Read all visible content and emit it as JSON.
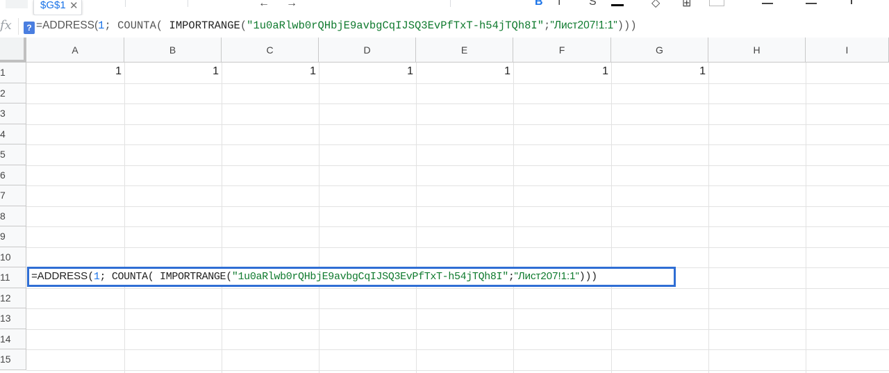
{
  "toolbar": {
    "name_box_value": "$G$1",
    "name_box_close": "✕"
  },
  "formula_bar": {
    "fx_label": "fx",
    "help_badge": "?",
    "formula": {
      "eq": "=",
      "fn1": "ADDRESS",
      "open1": "(",
      "arg1": "1",
      "sep1": "; ",
      "fn2": "COUNTA",
      "open2": "( ",
      "fn3": "IMPORTRANGE",
      "open3": "(",
      "str1": "\"1u0aRlwb0rQHbjE9avbgCqIJSQ3EvPfTxT-h54jTQh8I\"",
      "sep2": ";",
      "str2": "\"Лист207!1:1\"",
      "close": ")))"
    }
  },
  "columns": [
    "A",
    "B",
    "C",
    "D",
    "E",
    "F",
    "G",
    "H",
    "I"
  ],
  "rows": [
    "1",
    "2",
    "3",
    "4",
    "5",
    "6",
    "7",
    "8",
    "9",
    "10",
    "11",
    "12",
    "13",
    "14",
    "15"
  ],
  "row1_values": [
    "1",
    "1",
    "1",
    "1",
    "1",
    "1",
    "1"
  ],
  "edit_cell": {
    "reference": "A11",
    "formula": {
      "eq": "=",
      "fn1": "ADDRESS",
      "open1": "(",
      "arg1": "1",
      "sep1": "; ",
      "fn2": "COUNTA",
      "open2": "( ",
      "fn3": "IMPORTRANGE",
      "open3": "(",
      "str1": "\"1u0aRlwb0rQHbjE9avbgCqIJSQ3EvPfTxT-h54jTQh8I\"",
      "sep2": ";",
      "str2": "\"Лист207!1:1\"",
      "close": ")))"
    }
  },
  "colors": {
    "accent": "#1a73e8",
    "string": "#0f7a2e",
    "selection": "#2f6ed4"
  }
}
